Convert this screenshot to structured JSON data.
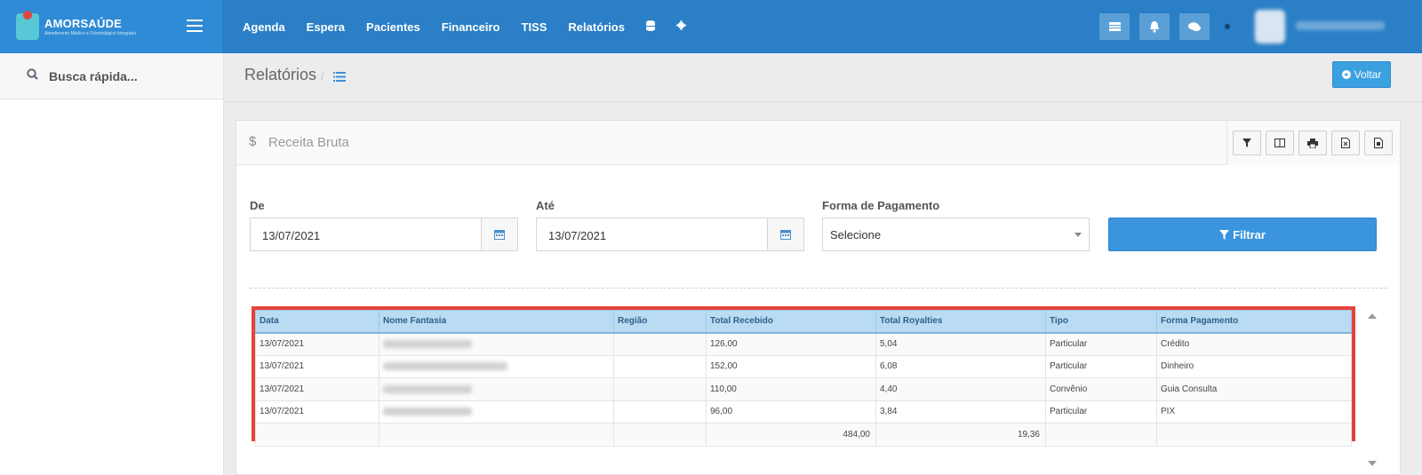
{
  "brand": {
    "title": "AMORSAÚDE",
    "subtitle": "Atendimento Médico e Odontológico Integrado"
  },
  "nav": {
    "items": [
      "Agenda",
      "Espera",
      "Pacientes",
      "Financeiro",
      "TISS",
      "Relatórios"
    ],
    "icons": [
      "database-icon",
      "gear-icon"
    ]
  },
  "topbar_icons": [
    "list-card-icon",
    "bell-icon",
    "chat-icon"
  ],
  "sidebar": {
    "search_placeholder": "Busca rápida..."
  },
  "page": {
    "title": "Relatórios",
    "back_label": "Voltar"
  },
  "report": {
    "title": "Receita Bruta",
    "dollar": "$",
    "tools": [
      "filter-icon",
      "columns-icon",
      "print-icon",
      "excel-icon",
      "pdf-icon"
    ],
    "filters": {
      "from_label": "De",
      "from_value": "13/07/2021",
      "to_label": "Até",
      "to_value": "13/07/2021",
      "payment_label": "Forma de Pagamento",
      "payment_value": "Selecione",
      "filter_button": "Filtrar"
    },
    "table": {
      "headers": [
        "Data",
        "Nome Fantasia",
        "Região",
        "Total Recebido",
        "Total Royalties",
        "Tipo",
        "Forma Pagamento"
      ],
      "rows": [
        {
          "data": "13/07/2021",
          "regiao": "",
          "total_recebido": "126,00",
          "total_royalties": "5,04",
          "tipo": "Particular",
          "forma": "Crédito"
        },
        {
          "data": "13/07/2021",
          "regiao": "",
          "total_recebido": "152,00",
          "total_royalties": "6,08",
          "tipo": "Particular",
          "forma": "Dinheiro"
        },
        {
          "data": "13/07/2021",
          "regiao": "",
          "total_recebido": "110,00",
          "total_royalties": "4,40",
          "tipo": "Convênio",
          "forma": "Guia Consulta"
        },
        {
          "data": "13/07/2021",
          "regiao": "",
          "total_recebido": "96,00",
          "total_royalties": "3,84",
          "tipo": "Particular",
          "forma": "PIX"
        }
      ],
      "totals": {
        "total_recebido": "484,00",
        "total_royalties": "19,36"
      }
    }
  },
  "colors": {
    "topbar": "#2a7fc6",
    "brand": "#2f8bd6",
    "accent": "#3a95de",
    "highlight_border": "#e6423a",
    "table_header": "#b9dcf3"
  }
}
